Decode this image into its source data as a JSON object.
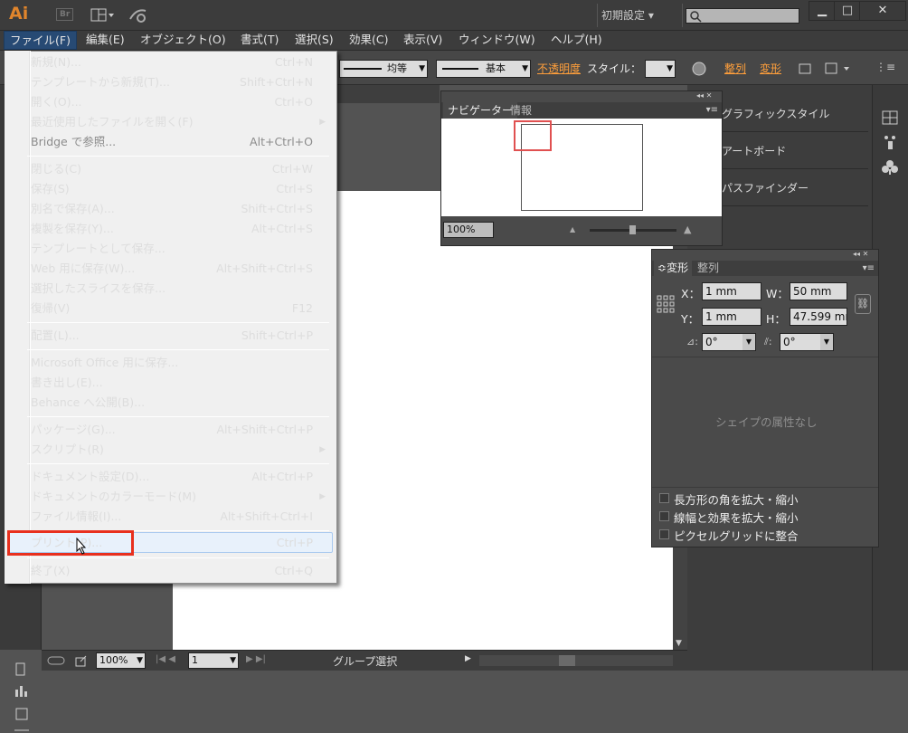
{
  "title_bar": {
    "app_logo": "Ai",
    "bridge_logo": "Br",
    "workspace": "初期設定"
  },
  "menu_bar": [
    "ファイル(F)",
    "編集(E)",
    "オブジェクト(O)",
    "書式(T)",
    "選択(S)",
    "効果(C)",
    "表示(V)",
    "ウィンドウ(W)",
    "ヘルプ(H)"
  ],
  "control_bar": {
    "stroke_style": "均等",
    "brush": "基本",
    "opacity": "不透明度",
    "style": "スタイル：",
    "align": "整列",
    "transform": "変形"
  },
  "file_menu": [
    {
      "label": "新規(N)...",
      "shortcut": "Ctrl+N"
    },
    {
      "label": "テンプレートから新規(T)...",
      "shortcut": "Shift+Ctrl+N"
    },
    {
      "label": "開く(O)...",
      "shortcut": "Ctrl+O"
    },
    {
      "label": "最近使用したファイルを開く(F)",
      "shortcut": ""
    },
    {
      "label": "Bridge で参照...",
      "shortcut": "Alt+Ctrl+O"
    },
    {
      "label": "閉じる(C)",
      "shortcut": "Ctrl+W"
    },
    {
      "label": "保存(S)",
      "shortcut": "Ctrl+S"
    },
    {
      "label": "別名で保存(A)...",
      "shortcut": "Shift+Ctrl+S"
    },
    {
      "label": "複製を保存(Y)...",
      "shortcut": "Alt+Ctrl+S"
    },
    {
      "label": "テンプレートとして保存...",
      "shortcut": ""
    },
    {
      "label": "Web 用に保存(W)...",
      "shortcut": "Alt+Shift+Ctrl+S"
    },
    {
      "label": "選択したスライスを保存...",
      "shortcut": ""
    },
    {
      "label": "復帰(V)",
      "shortcut": "F12"
    },
    {
      "label": "配置(L)...",
      "shortcut": "Shift+Ctrl+P"
    },
    {
      "label": "Microsoft Office 用に保存...",
      "shortcut": ""
    },
    {
      "label": "書き出し(E)...",
      "shortcut": ""
    },
    {
      "label": "Behance へ公開(B)...",
      "shortcut": ""
    },
    {
      "label": "パッケージ(G)...",
      "shortcut": "Alt+Shift+Ctrl+P"
    },
    {
      "label": "スクリプト(R)",
      "shortcut": ""
    },
    {
      "label": "ドキュメント設定(D)...",
      "shortcut": "Alt+Ctrl+P"
    },
    {
      "label": "ドキュメントのカラーモード(M)",
      "shortcut": ""
    },
    {
      "label": "ファイル情報(I)...",
      "shortcut": "Alt+Shift+Ctrl+I"
    },
    {
      "label": "プリント(P)...",
      "shortcut": "Ctrl+P"
    },
    {
      "label": "終了(X)",
      "shortcut": "Ctrl+Q"
    }
  ],
  "navigator": {
    "tabs": [
      "ナビゲーター",
      "情報"
    ],
    "zoom": "100%"
  },
  "dock": {
    "items": [
      "グラフィックスタイル",
      "アートボード",
      "パスファインダー"
    ]
  },
  "transform_panel": {
    "tabs": [
      "変形",
      "整列"
    ],
    "x_label": "X：",
    "x": "1 mm",
    "y_label": "Y：",
    "y": "1 mm",
    "w_label": "W：",
    "w": "50 mm",
    "h_label": "H：",
    "h": "47.599 mı",
    "angle": "0°",
    "shear": "0°",
    "empty": "シェイプの属性なし",
    "checks": [
      "長方形の角を拡大・縮小",
      "線幅と効果を拡大・縮小",
      "ピクセルグリッドに整合"
    ]
  },
  "status_bar": {
    "zoom": "100%",
    "page": "1",
    "mode": "グループ選択"
  }
}
